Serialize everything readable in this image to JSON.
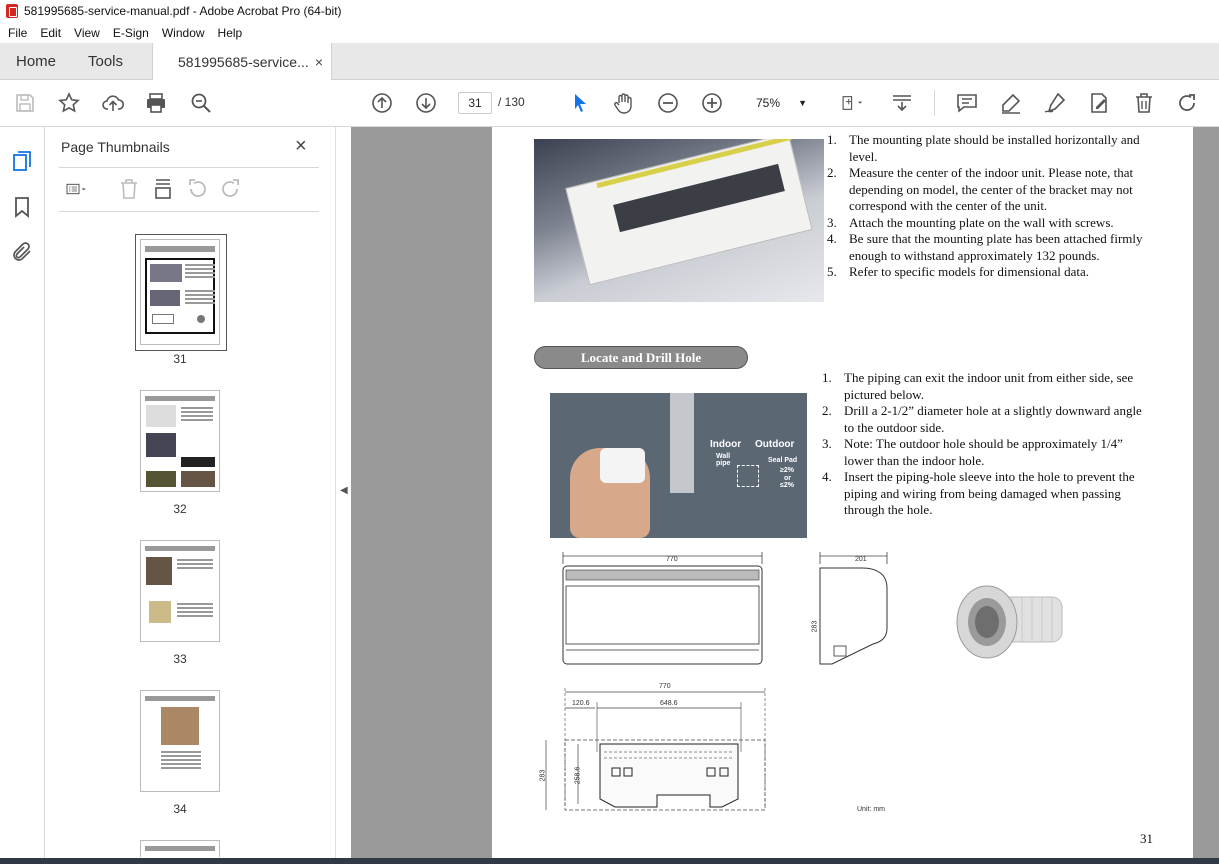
{
  "window": {
    "title": "581995685-service-manual.pdf - Adobe Acrobat Pro (64-bit)"
  },
  "menu": [
    "File",
    "Edit",
    "View",
    "E-Sign",
    "Window",
    "Help"
  ],
  "tabs": {
    "home": "Home",
    "tools": "Tools",
    "doc": "581995685-service...",
    "close": "×"
  },
  "toolbar": {
    "page_current": "31",
    "page_total": "/ 130",
    "zoom": "75%"
  },
  "panel": {
    "title": "Page Thumbnails",
    "close": "×"
  },
  "thumbnails": [
    {
      "num": "31",
      "selected": true
    },
    {
      "num": "32",
      "selected": false
    },
    {
      "num": "33",
      "selected": false
    },
    {
      "num": "34",
      "selected": false
    }
  ],
  "page": {
    "list1": [
      {
        "n": "1.",
        "t": "The mounting plate should be installed horizontally and level."
      },
      {
        "n": "2.",
        "t": "Measure the center of the indoor unit. Please note, that depending on model, the center of the bracket may not correspond with the center of the unit."
      },
      {
        "n": "3.",
        "t": "Attach the mounting plate on the wall with screws."
      },
      {
        "n": "4.",
        "t": "Be sure that the mounting plate has been attached firmly enough to withstand  approximately 132 pounds."
      },
      {
        "n": "5.",
        "t": "Refer to specific models for dimensional data."
      }
    ],
    "section": "Locate and Drill Hole",
    "photo_labels": {
      "indoor": "Indoor",
      "outdoor": "Outdoor",
      "wall_pipe": "Wall pipe",
      "seal_pad": "Seal Pad",
      "slope1": "≥2%",
      "or": "or",
      "slope2": "≤2%"
    },
    "list2": [
      {
        "n": "1.",
        "t": "The piping can exit the indoor unit from either side, see pictured below."
      },
      {
        "n": "2.",
        "t": "Drill a 2-1/2” diameter hole at a slightly downward angle to the outdoor side."
      },
      {
        "n": "3.",
        "t": "Note: The outdoor hole should be approximately 1/4” lower than the indoor hole."
      },
      {
        "n": "4.",
        "t": "Insert the piping-hole sleeve into the hole to prevent the piping and wiring from being damaged when passing through the hole."
      }
    ],
    "dims": {
      "front_width": "770",
      "side_depth": "201",
      "height": "283",
      "plate_width": "770",
      "left_offset": "120.6",
      "center": "648.6",
      "plate_h1": "283",
      "plate_h2": "258.6",
      "unit": "Unit: mm"
    },
    "number": "31"
  }
}
